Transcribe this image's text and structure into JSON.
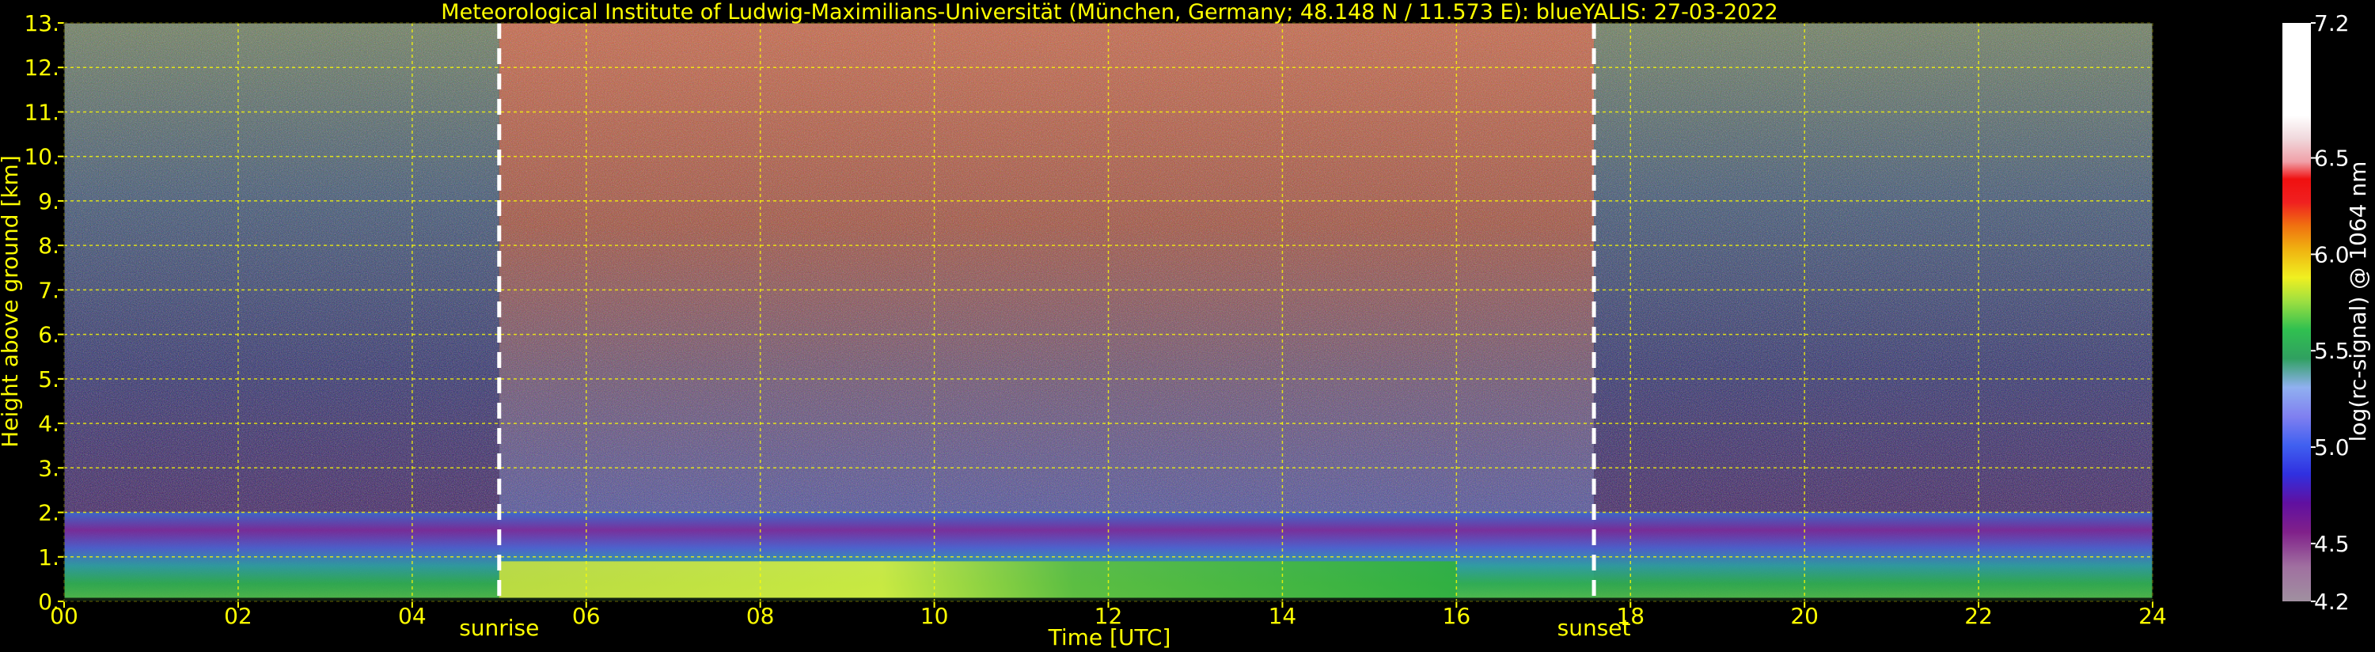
{
  "chart_data": {
    "type": "heatmap",
    "title": "Meteorological Institute of Ludwig-Maximilians-Universität (München, Germany; 48.148 N / 11.573 E):    blueYALIS: 27-03-2022",
    "xlabel": "Time [UTC]",
    "ylabel": "Height above ground [km]",
    "xlim": [
      0,
      24
    ],
    "ylim": [
      0,
      13
    ],
    "x_ticks": [
      "00",
      "02",
      "04",
      "06",
      "08",
      "10",
      "12",
      "14",
      "16",
      "18",
      "20",
      "22",
      "24"
    ],
    "y_ticks": [
      "0.",
      "1.",
      "2.",
      "3.",
      "4.",
      "5.",
      "6.",
      "7.",
      "8.",
      "9.",
      "10.",
      "11.",
      "12.",
      "13."
    ],
    "grid": true,
    "colorbar": {
      "label": "log(rc-signal) @ 1064 nm",
      "range": [
        4.2,
        7.2
      ],
      "ticks": [
        "4.2",
        "4.5",
        "5.0",
        "5.5",
        "6.0",
        "6.5",
        "7.2"
      ]
    },
    "markers": [
      {
        "label": "sunrise",
        "x": 5.0
      },
      {
        "label": "sunset",
        "x": 17.58
      }
    ]
  },
  "colors": {
    "background": "#000000",
    "text": "#ffff00",
    "grid": "#ffff00",
    "marker_line": "#ffffff",
    "colorbar_label": "#ffffff"
  }
}
